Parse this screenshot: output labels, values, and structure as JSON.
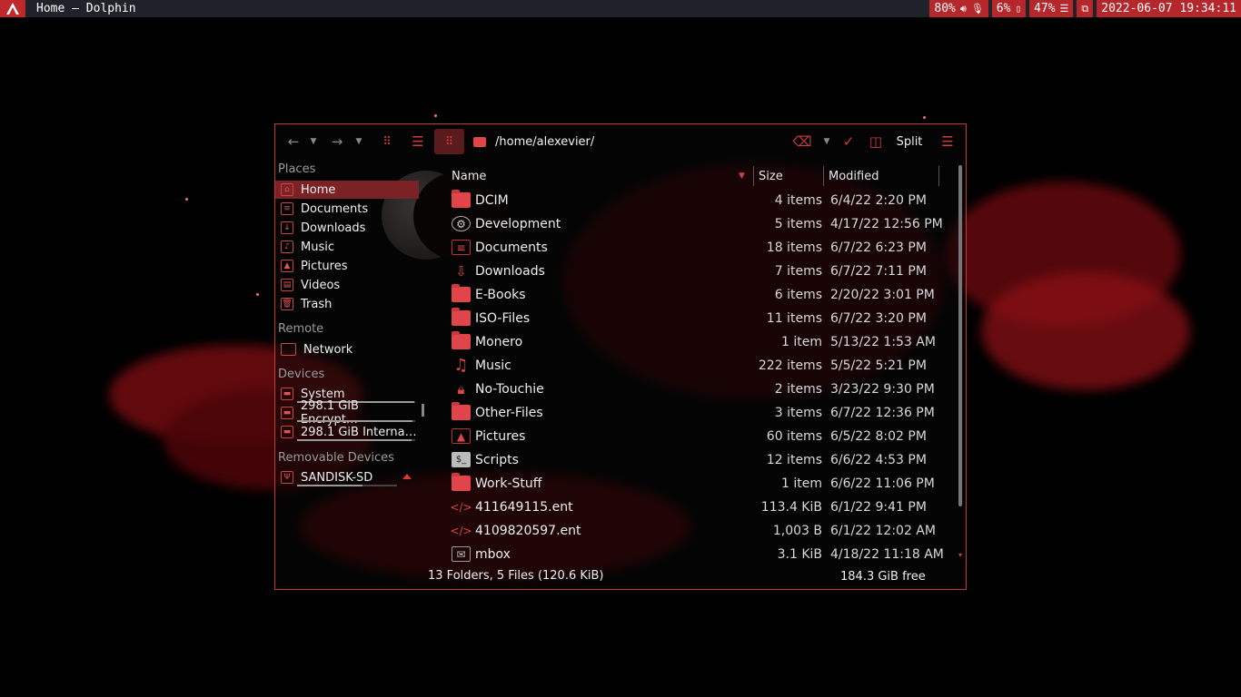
{
  "panel": {
    "window_title": "Home — Dolphin",
    "volume": "80%",
    "cpu": "6%",
    "memory": "47%",
    "datetime": "2022-06-07 19:34:11",
    "accent": "#b5272b"
  },
  "toolbar": {
    "path": "/home/alexevier/",
    "split_label": "Split"
  },
  "sidebar": {
    "places_title": "Places",
    "places": [
      {
        "label": "Home",
        "icon": "home-icon"
      },
      {
        "label": "Documents",
        "icon": "documents-icon"
      },
      {
        "label": "Downloads",
        "icon": "downloads-icon"
      },
      {
        "label": "Music",
        "icon": "music-icon"
      },
      {
        "label": "Pictures",
        "icon": "pictures-icon"
      },
      {
        "label": "Videos",
        "icon": "videos-icon"
      },
      {
        "label": "Trash",
        "icon": "trash-icon"
      }
    ],
    "remote_title": "Remote",
    "remote": [
      {
        "label": "Network",
        "icon": "network-folder-icon"
      }
    ],
    "devices_title": "Devices",
    "devices": [
      {
        "label": "System",
        "icon": "drive-icon",
        "usage": 0.99
      },
      {
        "label": "298.1 GiB Encrypt…",
        "icon": "encrypted-drive-icon",
        "usage": 0.98
      },
      {
        "label": "298.1 GiB Interna…",
        "icon": "drive-icon",
        "usage": 0.97
      }
    ],
    "removable_title": "Removable Devices",
    "removable": [
      {
        "label": "SANDISK-SD",
        "icon": "usb-drive-icon",
        "usage": 0.65
      }
    ]
  },
  "columns": {
    "name": "Name",
    "size": "Size",
    "modified": "Modified"
  },
  "files": [
    {
      "name": "DCIM",
      "size": "4 items",
      "modified": "6/4/22 2:20 PM",
      "icon": "folder-icon"
    },
    {
      "name": "Development",
      "size": "5 items",
      "modified": "4/17/22 12:56 PM",
      "icon": "gear-folder-icon"
    },
    {
      "name": "Documents",
      "size": "18 items",
      "modified": "6/7/22 6:23 PM",
      "icon": "documents-folder-icon"
    },
    {
      "name": "Downloads",
      "size": "7 items",
      "modified": "6/7/22 7:11 PM",
      "icon": "downloads-folder-icon"
    },
    {
      "name": "E-Books",
      "size": "6 items",
      "modified": "2/20/22 3:01 PM",
      "icon": "folder-icon"
    },
    {
      "name": "ISO-Files",
      "size": "11 items",
      "modified": "6/7/22 3:20 PM",
      "icon": "folder-icon"
    },
    {
      "name": "Monero",
      "size": "1 item",
      "modified": "5/13/22 1:53 AM",
      "icon": "folder-icon"
    },
    {
      "name": "Music",
      "size": "222 items",
      "modified": "5/5/22 5:21 PM",
      "icon": "music-folder-icon"
    },
    {
      "name": "No-Touchie",
      "size": "2 items",
      "modified": "3/23/22 9:30 PM",
      "icon": "lock-folder-icon"
    },
    {
      "name": "Other-Files",
      "size": "3 items",
      "modified": "6/7/22 12:36 PM",
      "icon": "folder-icon"
    },
    {
      "name": "Pictures",
      "size": "60 items",
      "modified": "6/5/22 8:02 PM",
      "icon": "pictures-folder-icon"
    },
    {
      "name": "Scripts",
      "size": "12 items",
      "modified": "6/6/22 4:53 PM",
      "icon": "terminal-folder-icon"
    },
    {
      "name": "Work-Stuff",
      "size": "1 item",
      "modified": "6/6/22 11:06 PM",
      "icon": "folder-icon"
    },
    {
      "name": "411649115.ent",
      "size": "113.4 KiB",
      "modified": "6/1/22 9:41 PM",
      "icon": "code-file-icon"
    },
    {
      "name": "4109820597.ent",
      "size": "1,003 B",
      "modified": "6/1/22 12:02 AM",
      "icon": "code-file-icon"
    },
    {
      "name": "mbox",
      "size": "3.1 KiB",
      "modified": "4/18/22 11:18 AM",
      "icon": "mailbox-file-icon"
    }
  ],
  "status": {
    "summary": "13 Folders, 5 Files (120.6 KiB)",
    "free": "184.3 GiB free"
  }
}
